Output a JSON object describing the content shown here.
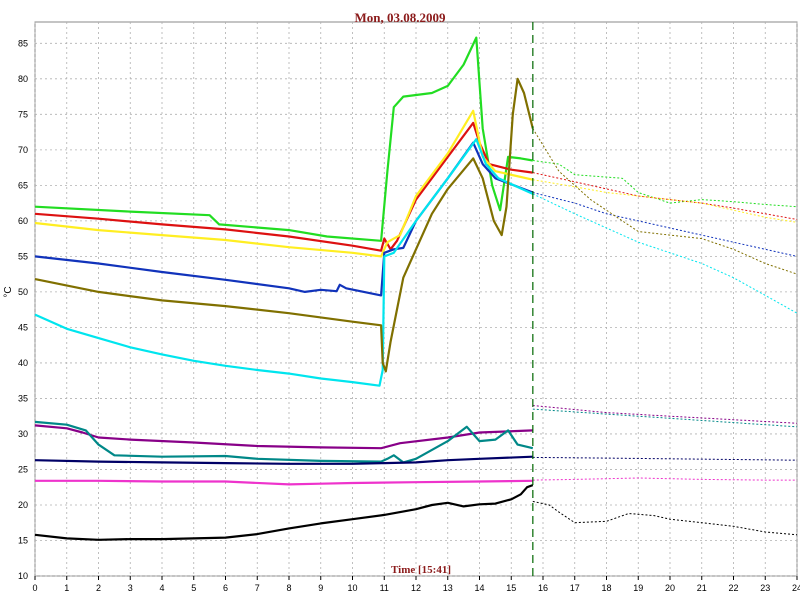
{
  "chart_data": {
    "type": "line",
    "title": "Mon, 03.08.2009",
    "xlabel": "Time [15:41]",
    "ylabel": "°C",
    "xlim": [
      0,
      24
    ],
    "ylim": [
      10,
      88
    ],
    "x_ticks": [
      0,
      1,
      2,
      3,
      4,
      5,
      6,
      7,
      8,
      9,
      10,
      11,
      12,
      13,
      14,
      15,
      16,
      17,
      18,
      19,
      20,
      21,
      22,
      23,
      24
    ],
    "y_ticks": [
      10,
      15,
      20,
      25,
      30,
      35,
      40,
      45,
      50,
      55,
      60,
      65,
      70,
      75,
      80,
      85
    ],
    "grid": true,
    "now_marker_x": 15.68,
    "series": [
      {
        "color": "#22dd22",
        "points": [
          [
            0,
            62
          ],
          [
            3,
            61.3
          ],
          [
            5.5,
            60.8
          ],
          [
            5.8,
            59.5
          ],
          [
            8,
            58.7
          ],
          [
            9.2,
            57.8
          ],
          [
            10.9,
            57.2
          ],
          [
            11.1,
            67
          ],
          [
            11.3,
            76
          ],
          [
            11.6,
            77.5
          ],
          [
            12.5,
            78
          ],
          [
            13,
            79
          ],
          [
            13.5,
            82
          ],
          [
            13.9,
            85.8
          ],
          [
            14.1,
            73
          ],
          [
            14.4,
            65
          ],
          [
            14.65,
            61.5
          ],
          [
            14.9,
            69
          ],
          [
            15.3,
            68.8
          ],
          [
            15.68,
            68.5
          ]
        ],
        "forecast": [
          [
            15.68,
            68.5
          ],
          [
            16.5,
            68
          ],
          [
            17,
            66.5
          ],
          [
            18.5,
            66
          ],
          [
            19,
            64
          ],
          [
            20,
            62.5
          ],
          [
            21,
            63
          ],
          [
            22,
            62.7
          ],
          [
            23,
            62.3
          ],
          [
            24,
            62
          ]
        ]
      },
      {
        "color": "#dd1111",
        "points": [
          [
            0,
            61
          ],
          [
            2,
            60.3
          ],
          [
            4,
            59.5
          ],
          [
            6,
            58.8
          ],
          [
            8,
            57.8
          ],
          [
            10,
            56.5
          ],
          [
            10.9,
            55.8
          ],
          [
            11,
            57.5
          ],
          [
            11.2,
            56
          ],
          [
            11.4,
            57.2
          ],
          [
            12,
            63
          ],
          [
            13,
            69
          ],
          [
            13.8,
            73.8
          ],
          [
            14,
            71
          ],
          [
            14.3,
            68
          ],
          [
            15,
            67.2
          ],
          [
            15.68,
            66.8
          ]
        ],
        "forecast": [
          [
            15.68,
            66.8
          ],
          [
            17,
            65.5
          ],
          [
            18,
            64.5
          ],
          [
            19,
            63.5
          ],
          [
            20,
            63
          ],
          [
            21,
            62.5
          ],
          [
            22,
            61.8
          ],
          [
            23,
            61
          ],
          [
            24,
            60.2
          ]
        ]
      },
      {
        "color": "#ffee22",
        "points": [
          [
            0,
            59.7
          ],
          [
            2,
            58.7
          ],
          [
            4,
            58
          ],
          [
            6,
            57.3
          ],
          [
            8,
            56.3
          ],
          [
            10,
            55.5
          ],
          [
            10.9,
            55
          ],
          [
            11.1,
            57
          ],
          [
            11.5,
            58
          ],
          [
            12,
            63.5
          ],
          [
            13,
            69.5
          ],
          [
            13.8,
            75.5
          ],
          [
            14.1,
            69
          ],
          [
            14.5,
            67
          ],
          [
            15.68,
            65.8
          ]
        ],
        "forecast": [
          [
            15.68,
            65.8
          ],
          [
            17,
            64.8
          ],
          [
            18,
            64
          ],
          [
            19,
            63.5
          ],
          [
            20,
            63
          ],
          [
            21,
            62.5
          ],
          [
            22,
            61.5
          ],
          [
            23,
            60.5
          ],
          [
            24,
            59.8
          ]
        ]
      },
      {
        "color": "#1133bb",
        "points": [
          [
            0,
            55
          ],
          [
            2,
            54
          ],
          [
            4,
            52.8
          ],
          [
            6,
            51.7
          ],
          [
            8,
            50.5
          ],
          [
            8.5,
            50
          ],
          [
            9,
            50.3
          ],
          [
            9.5,
            50.1
          ],
          [
            9.6,
            51
          ],
          [
            9.8,
            50.5
          ],
          [
            10.9,
            49.5
          ],
          [
            11,
            55.5
          ],
          [
            11.3,
            56
          ],
          [
            11.6,
            56.2
          ],
          [
            12,
            60
          ],
          [
            13,
            66
          ],
          [
            13.8,
            71
          ],
          [
            14.1,
            68
          ],
          [
            14.5,
            66
          ],
          [
            15.68,
            64
          ]
        ],
        "forecast": [
          [
            15.68,
            64
          ],
          [
            17,
            62.5
          ],
          [
            18,
            61
          ],
          [
            19,
            60
          ],
          [
            20,
            59
          ],
          [
            21,
            58
          ],
          [
            22,
            57
          ],
          [
            23,
            56
          ],
          [
            24,
            55
          ]
        ]
      },
      {
        "color": "#00e5ee",
        "points": [
          [
            0,
            46.8
          ],
          [
            1,
            44.8
          ],
          [
            2,
            43.5
          ],
          [
            3,
            42.2
          ],
          [
            4,
            41.2
          ],
          [
            5,
            40.3
          ],
          [
            6,
            39.6
          ],
          [
            7,
            39
          ],
          [
            8,
            38.5
          ],
          [
            9,
            37.8
          ],
          [
            10,
            37.3
          ],
          [
            10.85,
            36.8
          ],
          [
            10.95,
            39
          ],
          [
            11,
            55
          ],
          [
            11.3,
            55.5
          ],
          [
            12,
            60
          ],
          [
            13,
            66
          ],
          [
            13.9,
            71.5
          ],
          [
            14.2,
            68
          ],
          [
            14.6,
            66
          ],
          [
            15.68,
            63.8
          ]
        ],
        "forecast": [
          [
            15.68,
            63.8
          ],
          [
            17,
            61
          ],
          [
            18,
            59
          ],
          [
            19,
            57
          ],
          [
            20,
            55.5
          ],
          [
            21,
            54
          ],
          [
            22,
            52
          ],
          [
            23,
            49.5
          ],
          [
            24,
            47
          ]
        ]
      },
      {
        "color": "#807000",
        "points": [
          [
            0,
            51.8
          ],
          [
            2,
            50
          ],
          [
            4,
            48.8
          ],
          [
            6,
            48
          ],
          [
            8,
            47
          ],
          [
            10,
            45.8
          ],
          [
            10.9,
            45.3
          ],
          [
            10.95,
            40
          ],
          [
            11.05,
            38.8
          ],
          [
            11.2,
            43
          ],
          [
            11.6,
            52
          ],
          [
            12,
            56
          ],
          [
            12.5,
            61
          ],
          [
            13,
            64.5
          ],
          [
            13.8,
            68.8
          ],
          [
            14.1,
            66
          ],
          [
            14.45,
            60
          ],
          [
            14.7,
            58
          ],
          [
            14.85,
            62
          ],
          [
            15.05,
            75
          ],
          [
            15.2,
            80
          ],
          [
            15.4,
            78
          ],
          [
            15.68,
            73
          ]
        ],
        "forecast": [
          [
            15.68,
            73
          ],
          [
            16.5,
            67
          ],
          [
            17.5,
            63
          ],
          [
            18.5,
            60
          ],
          [
            19,
            58.5
          ],
          [
            20,
            58
          ],
          [
            21,
            57.5
          ],
          [
            22,
            56
          ],
          [
            23,
            54
          ],
          [
            24,
            52.5
          ]
        ]
      },
      {
        "color": "#880088",
        "points": [
          [
            0,
            31.2
          ],
          [
            1,
            30.8
          ],
          [
            1.5,
            30.2
          ],
          [
            2,
            29.5
          ],
          [
            3,
            29.2
          ],
          [
            5,
            28.8
          ],
          [
            7,
            28.3
          ],
          [
            9,
            28.1
          ],
          [
            10.9,
            28
          ],
          [
            11.5,
            28.7
          ],
          [
            13,
            29.5
          ],
          [
            14,
            30.2
          ],
          [
            15.68,
            30.5
          ]
        ],
        "forecast": [
          [
            15.68,
            34
          ],
          [
            18,
            33
          ],
          [
            20,
            32.5
          ],
          [
            22,
            32
          ],
          [
            24,
            31.5
          ]
        ]
      },
      {
        "color": "#008888",
        "points": [
          [
            0,
            31.7
          ],
          [
            1,
            31.3
          ],
          [
            1.6,
            30.5
          ],
          [
            2,
            28.5
          ],
          [
            2.5,
            27
          ],
          [
            4,
            26.8
          ],
          [
            6,
            26.9
          ],
          [
            7,
            26.5
          ],
          [
            9,
            26.2
          ],
          [
            10.9,
            26.1
          ],
          [
            11.1,
            26.5
          ],
          [
            11.3,
            27
          ],
          [
            11.6,
            26
          ],
          [
            12,
            26.5
          ],
          [
            13,
            29
          ],
          [
            13.6,
            31
          ],
          [
            14,
            29
          ],
          [
            14.5,
            29.2
          ],
          [
            14.9,
            30.5
          ],
          [
            15.2,
            28.5
          ],
          [
            15.68,
            28
          ]
        ],
        "forecast": [
          [
            15.68,
            33.5
          ],
          [
            18,
            32.8
          ],
          [
            20,
            32.2
          ],
          [
            22,
            31.6
          ],
          [
            24,
            31
          ]
        ]
      },
      {
        "color": "#000066",
        "points": [
          [
            0,
            26.3
          ],
          [
            2,
            26.1
          ],
          [
            4,
            26
          ],
          [
            6,
            25.9
          ],
          [
            8,
            25.8
          ],
          [
            10,
            25.8
          ],
          [
            11,
            25.9
          ],
          [
            12,
            26
          ],
          [
            13,
            26.3
          ],
          [
            14,
            26.5
          ],
          [
            15.68,
            26.8
          ]
        ],
        "forecast": [
          [
            15.68,
            26.7
          ],
          [
            18,
            26.6
          ],
          [
            20,
            26.5
          ],
          [
            22,
            26.4
          ],
          [
            24,
            26.3
          ]
        ]
      },
      {
        "color": "#ee33cc",
        "points": [
          [
            0,
            23.4
          ],
          [
            2,
            23.4
          ],
          [
            4,
            23.3
          ],
          [
            6,
            23.3
          ],
          [
            8,
            22.9
          ],
          [
            9,
            23
          ],
          [
            10,
            23.1
          ],
          [
            12,
            23.2
          ],
          [
            14,
            23.3
          ],
          [
            15.68,
            23.4
          ]
        ],
        "forecast": [
          [
            15.68,
            23.5
          ],
          [
            17,
            23.6
          ],
          [
            19,
            23.8
          ],
          [
            21,
            23.6
          ],
          [
            23,
            23.5
          ],
          [
            24,
            23.5
          ]
        ]
      },
      {
        "color": "#000000",
        "points": [
          [
            0,
            15.8
          ],
          [
            1,
            15.3
          ],
          [
            2,
            15.1
          ],
          [
            3,
            15.2
          ],
          [
            4,
            15.2
          ],
          [
            5,
            15.3
          ],
          [
            6,
            15.4
          ],
          [
            7,
            15.9
          ],
          [
            8,
            16.7
          ],
          [
            9,
            17.4
          ],
          [
            10,
            18
          ],
          [
            11,
            18.6
          ],
          [
            12,
            19.4
          ],
          [
            12.5,
            20
          ],
          [
            13,
            20.3
          ],
          [
            13.5,
            19.8
          ],
          [
            14,
            20.1
          ],
          [
            14.5,
            20.2
          ],
          [
            15,
            20.8
          ],
          [
            15.3,
            21.5
          ],
          [
            15.5,
            22.5
          ],
          [
            15.68,
            22.8
          ]
        ],
        "forecast": [
          [
            15.68,
            20.5
          ],
          [
            16.2,
            20
          ],
          [
            16.5,
            19
          ],
          [
            17,
            17.5
          ],
          [
            18,
            17.7
          ],
          [
            18.7,
            18.8
          ],
          [
            19.5,
            18.5
          ],
          [
            20,
            18
          ],
          [
            21,
            17.5
          ],
          [
            22,
            17
          ],
          [
            23,
            16.2
          ],
          [
            24,
            15.8
          ]
        ]
      }
    ]
  }
}
